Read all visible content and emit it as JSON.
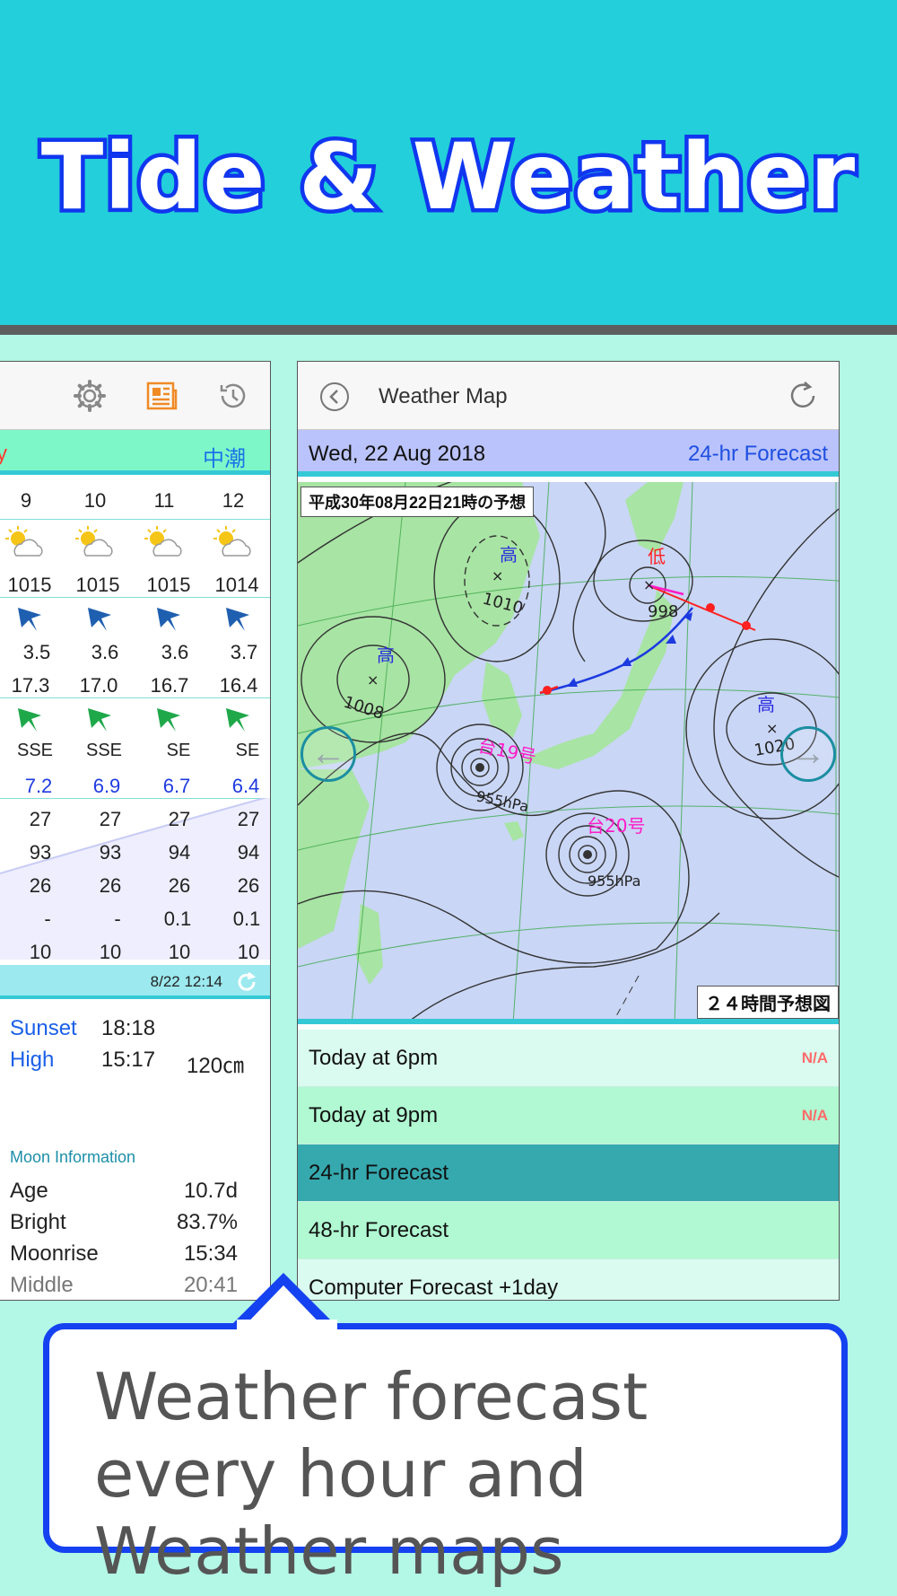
{
  "banner": {
    "title": "Tide & Weather"
  },
  "left_panel": {
    "tide_day_partial": "y",
    "tide_type": "中潮",
    "hours": [
      "9",
      "10",
      "11",
      "12"
    ],
    "pressure": [
      "1015",
      "1015",
      "1015",
      "1014"
    ],
    "wave_height": [
      "3.5",
      "3.6",
      "3.6",
      "3.7"
    ],
    "wave_period": [
      "17.3",
      "17.0",
      "16.7",
      "16.4"
    ],
    "wind_dir": [
      "SSE",
      "SSE",
      "SE",
      "SE"
    ],
    "wind_speed": [
      "7.2",
      "6.9",
      "6.7",
      "6.4"
    ],
    "temperature": [
      "27",
      "27",
      "27",
      "27"
    ],
    "humidity": [
      "93",
      "93",
      "94",
      "94"
    ],
    "water_temp": [
      "26",
      "26",
      "26",
      "26"
    ],
    "rain": [
      "-",
      "-",
      "0.1",
      "0.1"
    ],
    "cloud": [
      "10",
      "10",
      "10",
      "10"
    ],
    "updated": "8/22 12:14",
    "sunset_label": "Sunset",
    "sunset_time": "18:18",
    "high_label": "High",
    "high_time": "15:17",
    "high_level": "120㎝",
    "moon": {
      "heading": "Moon Information",
      "rows": [
        {
          "label": "Age",
          "value": "10.7d"
        },
        {
          "label": "Bright",
          "value": "83.7%"
        },
        {
          "label": "Moonrise",
          "value": "15:34"
        },
        {
          "label": "Middle",
          "value": "20:41"
        }
      ]
    }
  },
  "right_panel": {
    "title": "Weather Map",
    "date": "Wed, 22 Aug 2018",
    "forecast": "24-hr Forecast",
    "map_title": "平成30年08月22日21時の予想",
    "map_footer": "２４時間予想図",
    "map_labels": {
      "high": "高",
      "low": "低",
      "p1010": "1010",
      "p1008": "1008",
      "p998": "998",
      "p1020": "1020",
      "t19": "台19号",
      "t20": "台20号",
      "p955a": "955hPa",
      "p955b": "955hPa"
    },
    "list": [
      {
        "label": "Today at 6pm",
        "status": "N/A"
      },
      {
        "label": "Today at 9pm",
        "status": "N/A"
      },
      {
        "label": "24-hr Forecast",
        "status": ""
      },
      {
        "label": "48-hr Forecast",
        "status": ""
      },
      {
        "label": "Computer Forecast +1day",
        "status": ""
      }
    ]
  },
  "callout": {
    "text": "Weather forecast every hour and Weather maps"
  },
  "colors": {
    "banner": "#23cfda",
    "accent": "#1542f0",
    "background": "#b3f7e6",
    "selected_row": "#35a9ae"
  }
}
